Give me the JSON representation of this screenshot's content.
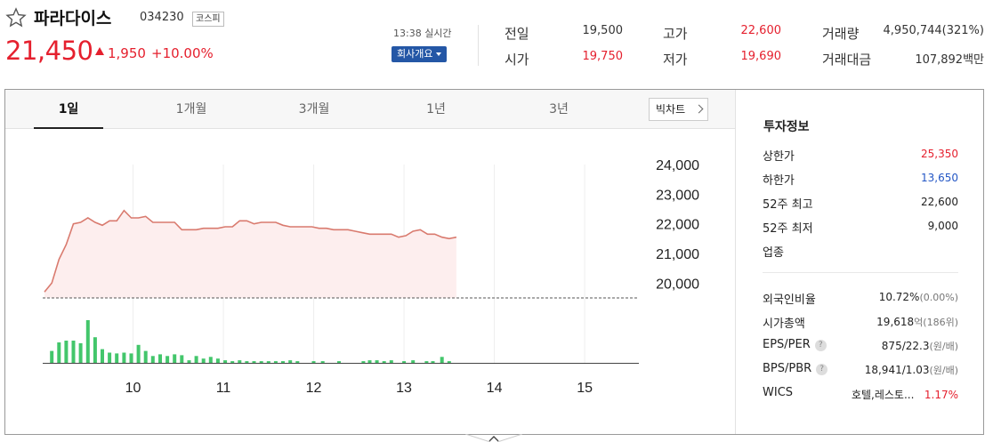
{
  "header": {
    "stock_name": "파라다이스",
    "stock_code": "034230",
    "market": "코스피",
    "price": "21,450",
    "change_amount": "1,950",
    "change_percent": "+10.00%",
    "realtime": "13:38 실시간",
    "company_button": "회사개요"
  },
  "quote": {
    "prev_label": "전일",
    "prev_value": "19,500",
    "high_label": "고가",
    "high_value": "22,600",
    "volume_label": "거래량",
    "volume_value": "4,950,744(321%)",
    "open_label": "시가",
    "open_value": "19,750",
    "low_label": "저가",
    "low_value": "19,690",
    "amount_label": "거래대금",
    "amount_value": "107,892백만"
  },
  "tabs": [
    "1일",
    "1개월",
    "3개월",
    "1년",
    "3년"
  ],
  "big_chart_label": "빅차트",
  "chart_data": {
    "type": "area",
    "y_ticks": [
      "24,000",
      "23,000",
      "22,000",
      "21,000",
      "20,000"
    ],
    "x_ticks": [
      "10",
      "11",
      "12",
      "13",
      "14",
      "15"
    ],
    "ylim": [
      19500,
      24000
    ],
    "xlim": [
      9.0,
      15.6
    ],
    "baseline": 19500,
    "price_series": {
      "x": [
        9.02,
        9.1,
        9.18,
        9.26,
        9.34,
        9.42,
        9.5,
        9.58,
        9.66,
        9.74,
        9.82,
        9.9,
        9.98,
        10.06,
        10.14,
        10.22,
        10.3,
        10.38,
        10.46,
        10.54,
        10.62,
        10.7,
        10.78,
        10.86,
        10.94,
        11.02,
        11.1,
        11.18,
        11.26,
        11.34,
        11.42,
        11.5,
        11.58,
        11.66,
        11.74,
        11.82,
        11.9,
        11.98,
        12.06,
        12.14,
        12.22,
        12.3,
        12.38,
        12.46,
        12.54,
        12.62,
        12.7,
        12.78,
        12.86,
        12.94,
        13.02,
        13.1,
        13.18,
        13.26,
        13.34,
        13.42,
        13.5,
        13.58
      ],
      "values": [
        19700,
        20000,
        20800,
        21300,
        22000,
        22050,
        22200,
        22050,
        21950,
        22100,
        22100,
        22450,
        22200,
        22200,
        22250,
        22050,
        22050,
        22050,
        22050,
        21800,
        21800,
        21800,
        21850,
        21850,
        21850,
        21900,
        21900,
        22100,
        22100,
        22000,
        22050,
        22050,
        22050,
        21950,
        21900,
        21900,
        21900,
        21900,
        21850,
        21850,
        21800,
        21800,
        21800,
        21750,
        21700,
        21650,
        21650,
        21650,
        21650,
        21550,
        21600,
        21750,
        21800,
        21650,
        21650,
        21550,
        21500,
        21550
      ]
    },
    "volume_series": {
      "x": [
        9.1,
        9.18,
        9.26,
        9.34,
        9.42,
        9.5,
        9.58,
        9.66,
        9.74,
        9.82,
        9.9,
        9.98,
        10.06,
        10.14,
        10.22,
        10.3,
        10.38,
        10.46,
        10.54,
        10.62,
        10.7,
        10.78,
        10.86,
        10.94,
        11.02,
        11.1,
        11.18,
        11.26,
        11.34,
        11.42,
        11.5,
        11.58,
        11.66,
        11.74,
        11.82,
        12.0,
        12.1,
        12.28,
        12.55,
        12.62,
        12.7,
        12.78,
        12.86,
        13.0,
        13.1,
        13.25,
        13.32,
        13.42,
        13.5
      ],
      "values": [
        0.28,
        0.48,
        0.52,
        0.52,
        0.46,
        1.0,
        0.6,
        0.32,
        0.24,
        0.22,
        0.24,
        0.22,
        0.42,
        0.28,
        0.16,
        0.2,
        0.16,
        0.2,
        0.18,
        0.06,
        0.16,
        0.1,
        0.14,
        0.1,
        0.06,
        0.04,
        0.06,
        0.04,
        0.04,
        0.04,
        0.04,
        0.04,
        0.04,
        0.06,
        0.04,
        0.04,
        0.04,
        0.04,
        0.04,
        0.06,
        0.06,
        0.04,
        0.06,
        0.04,
        0.06,
        0.04,
        0.04,
        0.14,
        0.04
      ]
    },
    "colors": {
      "line": "#d97a6e",
      "fill": "#fdeeee",
      "volume": "#43c66b",
      "baseline": "#555555"
    }
  },
  "info": {
    "title": "투자정보",
    "upper_limit_label": "상한가",
    "upper_limit_value": "25,350",
    "lower_limit_label": "하한가",
    "lower_limit_value": "13,650",
    "w52_high_label": "52주 최고",
    "w52_high_value": "22,600",
    "w52_low_label": "52주 최저",
    "w52_low_value": "9,000",
    "sector_label": "업종",
    "foreign_label": "외국인비율",
    "foreign_value": "10.72%",
    "foreign_sub": "(0.00%)",
    "mcap_label": "시가총액",
    "mcap_value": "19,618",
    "mcap_unit": "억",
    "mcap_sub": "(186위)",
    "eps_label": "EPS/PER",
    "eps_value": "875/22.3",
    "eps_unit": "(원/배)",
    "bps_label": "BPS/PBR",
    "bps_value": "18,941/1.03",
    "bps_unit": "(원/배)",
    "wics_label": "WICS",
    "wics_value": "호텔,레스토...",
    "wics_change": "1.17%"
  }
}
